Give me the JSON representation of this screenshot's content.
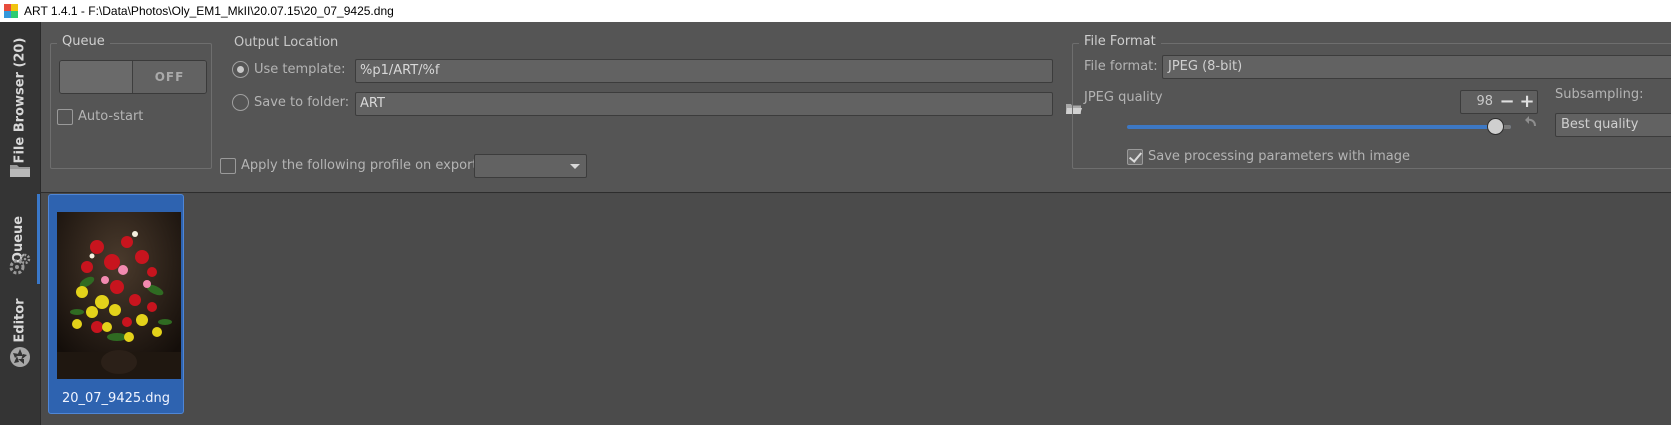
{
  "window": {
    "title": "ART 1.4.1 - F:\\Data\\Photos\\Oly_EM1_MkII\\20.07.15\\20_07_9425.dng"
  },
  "sidebar": {
    "tabs": [
      {
        "label": "File Browser (20)",
        "icon": "folder-icon"
      },
      {
        "label": "Queue",
        "icon": "gears-icon",
        "active": true
      },
      {
        "label": "Editor",
        "icon": "aperture-icon"
      }
    ]
  },
  "queue": {
    "group_label": "Queue",
    "switch_state": "OFF",
    "autostart_label": "Auto-start",
    "autostart_checked": false
  },
  "output": {
    "group_label": "Output Location",
    "use_template_label": "Use template:",
    "template_value": "%p1/ART/%f",
    "save_folder_label": "Save to folder:",
    "folder_value": "ART",
    "profile_label": "Apply the following profile on export:",
    "profile_value": ""
  },
  "format": {
    "group_label": "File Format",
    "file_format_label": "File format:",
    "file_format_value": "JPEG (8-bit)",
    "jpeg_quality_label": "JPEG quality",
    "jpeg_quality_value": "98",
    "jpeg_quality_fraction": 0.98,
    "subsampling_label": "Subsampling:",
    "subsampling_value": "Best quality",
    "save_params_label": "Save processing parameters with image",
    "save_params_checked": true
  },
  "thumbnails": [
    {
      "filename": "20_07_9425.dng",
      "selected": true
    }
  ],
  "colors": {
    "accent": "#3d78c4",
    "selection": "#2e63b0"
  }
}
